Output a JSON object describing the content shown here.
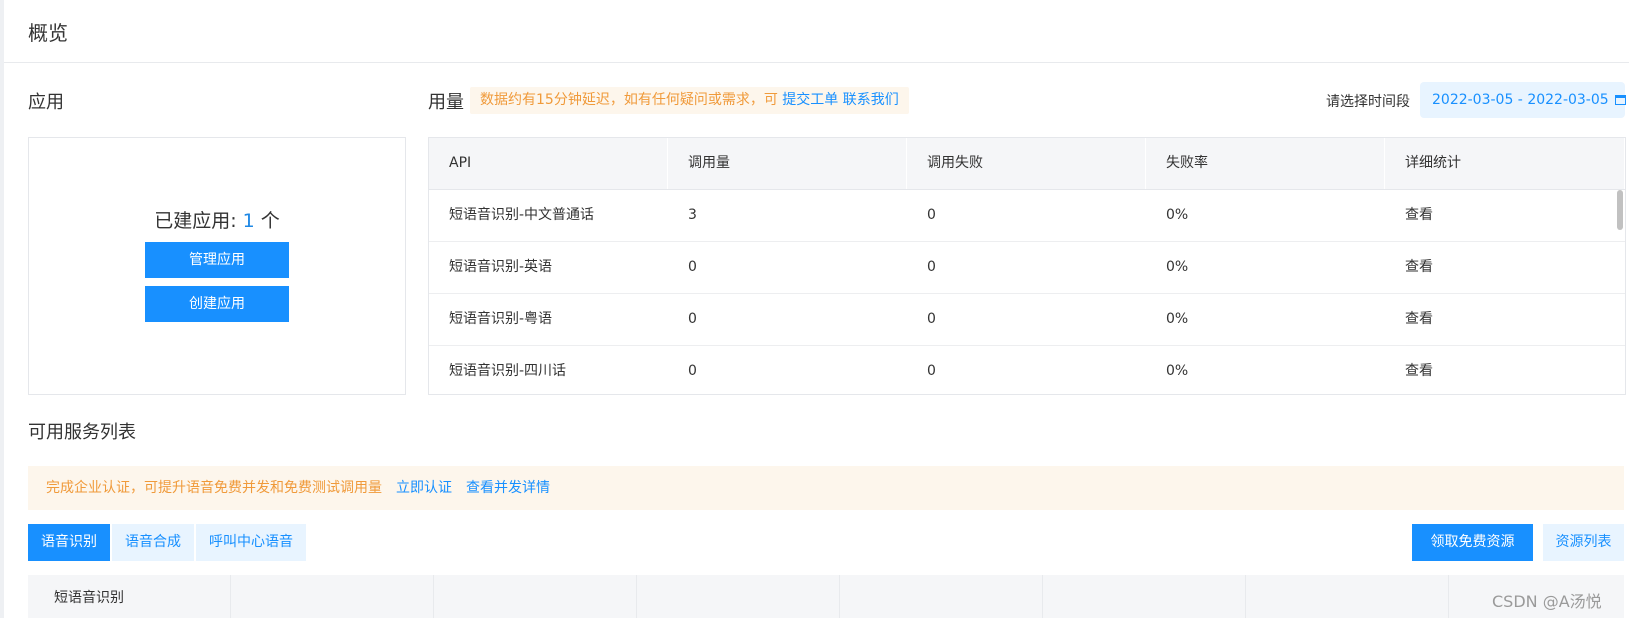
{
  "header": {
    "title": "概览"
  },
  "apps": {
    "section_title": "应用",
    "count_label": "已建应用: ",
    "count": "1",
    "count_unit": " 个",
    "manage_button": "管理应用",
    "create_button": "创建应用"
  },
  "usage": {
    "section_title": "用量",
    "notice": {
      "text": "数据约有15分钟延迟，如有任何疑问或需求，可 ",
      "link1": "提交工单",
      "link2": "联系我们"
    },
    "date_label": "请选择时间段",
    "date_range": "2022-03-05 - 2022-03-05",
    "table": {
      "headers": [
        "API",
        "调用量",
        "调用失败",
        "失败率",
        "详细统计"
      ],
      "rows": [
        {
          "api": "短语音识别-中文普通话",
          "calls": "3",
          "failed": "0",
          "rate": "0%",
          "detail": "查看"
        },
        {
          "api": "短语音识别-英语",
          "calls": "0",
          "failed": "0",
          "rate": "0%",
          "detail": "查看"
        },
        {
          "api": "短语音识别-粤语",
          "calls": "0",
          "failed": "0",
          "rate": "0%",
          "detail": "查看"
        },
        {
          "api": "短语音识别-四川话",
          "calls": "0",
          "failed": "0",
          "rate": "0%",
          "detail": "查看"
        }
      ]
    }
  },
  "services": {
    "section_title": "可用服务列表",
    "warning": {
      "text": "完成企业认证，可提升语音免费并发和免费测试调用量",
      "link1": "立即认证",
      "link2": "查看并发详情"
    },
    "tabs": [
      "语音识别",
      "语音合成",
      "呼叫中心语音"
    ],
    "active_tab": "语音识别",
    "free_button": "领取免费资源",
    "resource_button": "资源列表",
    "table_first_cell": "短语音识别"
  },
  "watermark": "CSDN @A汤悦",
  "colors": {
    "primary": "#1890ff",
    "warning_text": "#f09a3a",
    "warning_bg": "#fdf6ec"
  }
}
